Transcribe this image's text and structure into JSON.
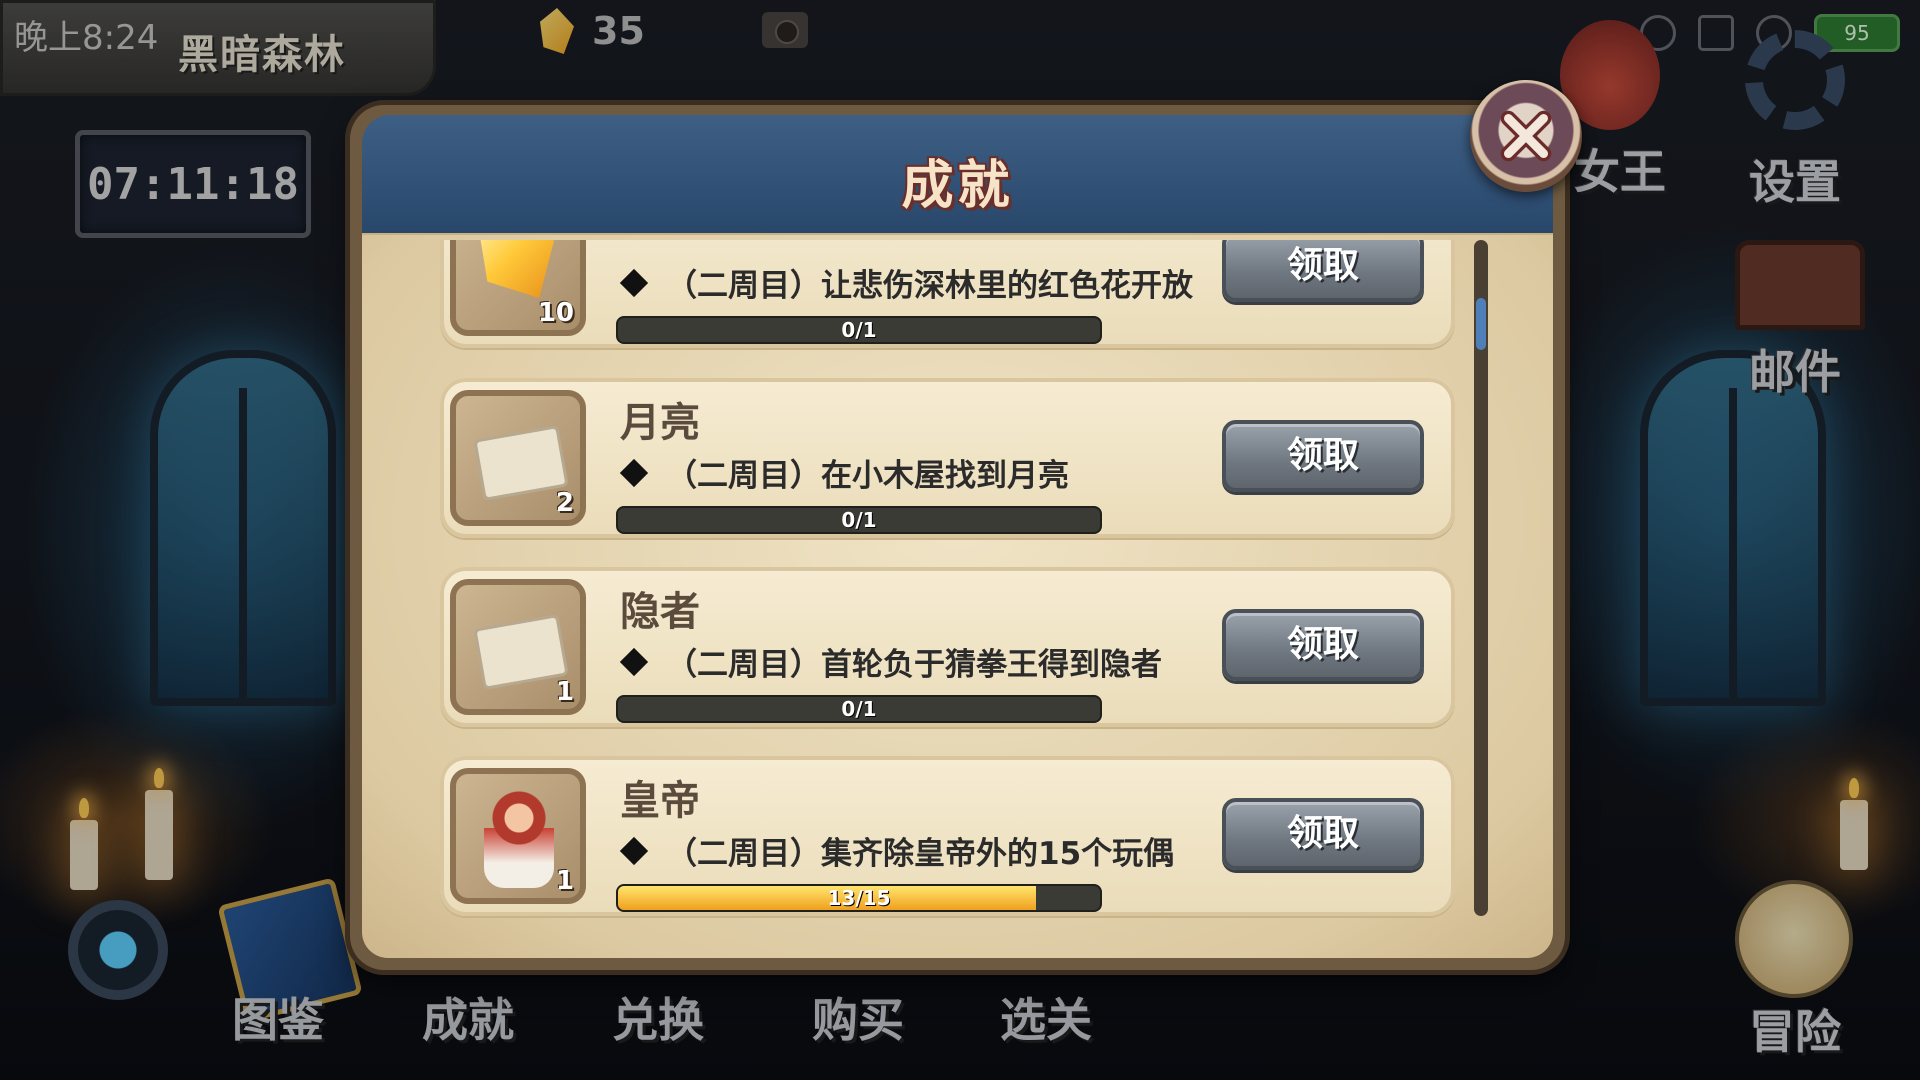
{
  "status_bar": {
    "time": "晚上8:24",
    "battery": "95"
  },
  "location": "黑暗森林",
  "timer": "07:11:18",
  "currency": {
    "icon": "gem-icon",
    "count": "35"
  },
  "side_menu": {
    "queen_label": "女王",
    "settings_label": "设置",
    "mail_label": "邮件",
    "adventure_label": "冒险"
  },
  "bottom_menu": [
    "图鉴",
    "成就",
    "兑换",
    "购买",
    "选关"
  ],
  "modal": {
    "title": "成就",
    "close_icon": "close-icon",
    "achievements": [
      {
        "name": "",
        "reward_icon": "gem-icon",
        "reward_count": "10",
        "description": "（二周目）让悲伤深林里的红色花开放",
        "progress_text": "0/1",
        "progress_fraction": 0,
        "claim_label": "领取"
      },
      {
        "name": "月亮",
        "reward_icon": "ticket-icon",
        "reward_count": "2",
        "description": "（二周目）在小木屋找到月亮",
        "progress_text": "0/1",
        "progress_fraction": 0,
        "claim_label": "领取"
      },
      {
        "name": "隐者",
        "reward_icon": "ticket-icon",
        "reward_count": "1",
        "description": "（二周目）首轮负于猜拳王得到隐者",
        "progress_text": "0/1",
        "progress_fraction": 0,
        "claim_label": "领取"
      },
      {
        "name": "皇帝",
        "reward_icon": "emperor-doll-icon",
        "reward_count": "1",
        "description": "（二周目）集齐除皇帝外的15个玩偶",
        "progress_text": "13/15",
        "progress_fraction": 0.867,
        "claim_label": "领取"
      }
    ]
  },
  "colors": {
    "header_blue": "#2f5078",
    "parchment": "#efe3c4",
    "progress_fill": "#f0a01e",
    "claim_button": "#7a828b"
  }
}
